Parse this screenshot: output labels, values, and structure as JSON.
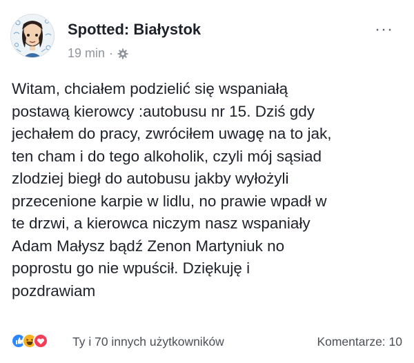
{
  "post": {
    "page_name": "Spotted: Białystok",
    "time": "19 min",
    "separator": "·",
    "audience_icon": "gear-icon",
    "more_label": "···",
    "text_lines": [
      "Witam, chciałem podzielić się wspaniałą",
      "postawą kierowcy :autobusu nr 15. Dziś gdy",
      "jechałem do pracy, zwróciłem uwagę na to jak,",
      "ten cham i do tego alkoholik, czyli mój sąsiad",
      "zlodziej biegł do autobusu jakby wyłożyli",
      "przecenione karpie w lidlu, no prawie wpadł w",
      "te drzwi, a kierowca niczym nasz wspaniały",
      "Adam Małysz bądź Zenon Martyniuk no",
      "poprostu go nie wpuścił. Dziękuję i",
      "pozdrawiam"
    ]
  },
  "footer": {
    "reaction_icons": [
      "like-icon",
      "haha-icon",
      "love-icon"
    ],
    "reactors": "Ty i 70 innych użytkowników",
    "comments": "Komentarze: 10"
  },
  "colors": {
    "like": "#2d88ff",
    "haha": "#f7b125",
    "love": "#f33e58",
    "text": "#1d2129",
    "meta": "#90949c"
  }
}
